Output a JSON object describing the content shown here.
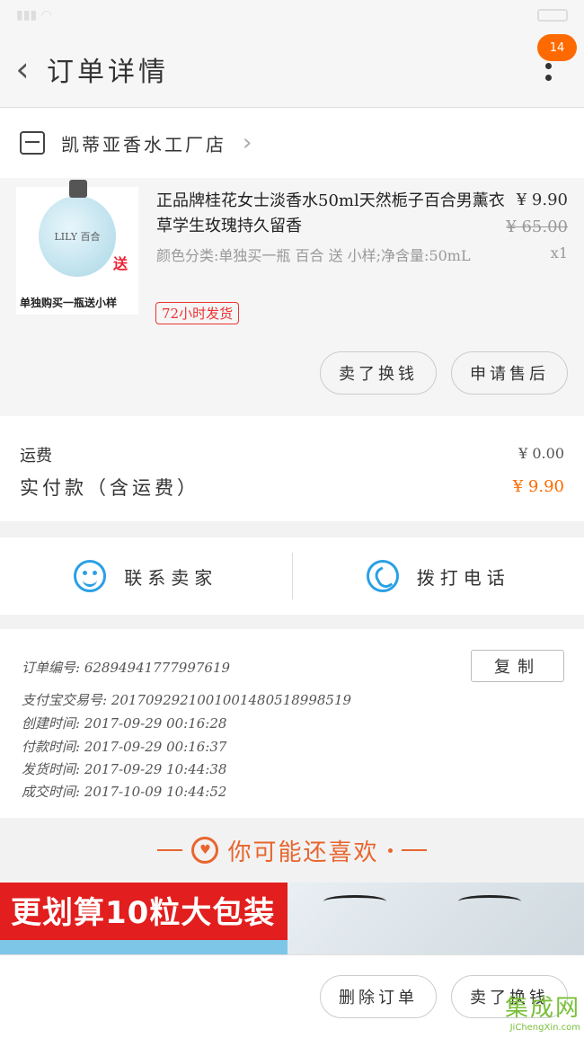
{
  "header": {
    "title": "订单详情",
    "badge": "14"
  },
  "shop": {
    "name": "凯蒂亚香水工厂店"
  },
  "product": {
    "thumb_label": "LILY 百合",
    "thumb_gift": "送",
    "thumb_caption": "单独购买一瓶送小样",
    "title": "正品牌桂花女士淡香水50ml天然栀子百合男薰衣草学生玫瑰持久留香",
    "spec": "颜色分类:单独买一瓶 百合 送 小样;净含量:50mL",
    "tag": "72小时发货",
    "price": "¥ 9.90",
    "original_price": "¥ 65.00",
    "quantity": "x1",
    "buttons": {
      "return": "卖了换钱",
      "after_sale": "申请售后"
    }
  },
  "fees": {
    "shipping_label": "运费",
    "shipping_value": "¥ 0.00",
    "paid_label": "实付款（含运费）",
    "paid_value": "¥ 9.90"
  },
  "contact": {
    "seller": "联系卖家",
    "call": "拨打电话"
  },
  "order_info": {
    "order_no": "订单编号:  62894941777997619",
    "alipay_no": "支付宝交易号:  2017092921001001480518998519",
    "created": "创建时间:  2017-09-29 00:16:28",
    "paid": "付款时间:  2017-09-29 00:16:37",
    "shipped": "发货时间:  2017-09-29 10:44:38",
    "completed": "成交时间:  2017-10-09 10:44:52",
    "copy_button": "复制"
  },
  "recommend": {
    "title": "你可能还喜欢"
  },
  "banners": {
    "left_text": "更划算10粒大包装"
  },
  "bottom_bar": {
    "delete": "删除订单",
    "return": "卖了换钱"
  },
  "watermark": {
    "main": "集成网",
    "sub": "JiChengXin.com"
  },
  "colors": {
    "accent": "#ff6a00",
    "blue": "#2aa0e5",
    "recommend": "#e8652e"
  }
}
